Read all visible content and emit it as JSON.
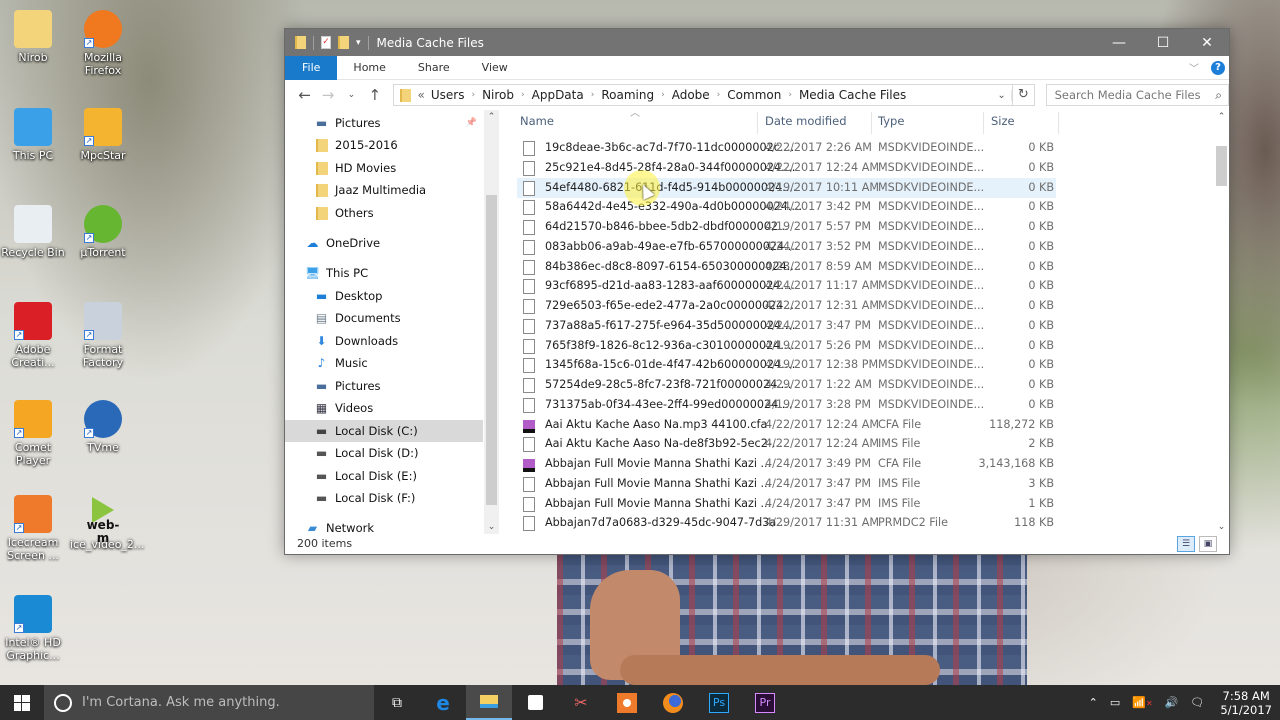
{
  "desktop": {
    "icons": [
      {
        "label": "Nirob",
        "icon": "user-folder-icon"
      },
      {
        "label": "Mozilla\nFirefox",
        "icon": "firefox-icon"
      },
      {
        "label": "This PC",
        "icon": "this-pc-icon"
      },
      {
        "label": "MpcStar",
        "icon": "mpcstar-icon"
      },
      {
        "label": "Recycle Bin",
        "icon": "recycle-bin-icon"
      },
      {
        "label": "µTorrent",
        "icon": "utorrent-icon"
      },
      {
        "label": "Adobe\nCreati...",
        "icon": "adobe-cc-icon"
      },
      {
        "label": "Format\nFactory",
        "icon": "format-factory-icon"
      },
      {
        "label": "Comet Player",
        "icon": "comet-player-icon"
      },
      {
        "label": "TVme",
        "icon": "tvme-icon"
      },
      {
        "label": "Icecream\nScreen ...",
        "icon": "icecream-icon"
      },
      {
        "label": "ice_video_2...",
        "icon": "webm-file-icon",
        "badge": "web-m"
      },
      {
        "label": "Intel® HD\nGraphic...",
        "icon": "intel-graphics-icon"
      }
    ]
  },
  "window": {
    "title": "Media Cache Files",
    "controls": {
      "minimize": "—",
      "maximize": "☐",
      "close": "✕"
    },
    "ribbon_tabs": [
      "File",
      "Home",
      "Share",
      "View"
    ],
    "address": {
      "overflow": "«",
      "crumbs": [
        "Users",
        "Nirob",
        "AppData",
        "Roaming",
        "Adobe",
        "Common",
        "Media Cache Files"
      ]
    },
    "search_placeholder": "Search Media Cache Files",
    "nav_pane": [
      {
        "label": "Pictures",
        "icon": "pictures-icon",
        "pinned": true
      },
      {
        "label": "2015-2016",
        "icon": "folder-icon"
      },
      {
        "label": "HD Movies",
        "icon": "folder-icon"
      },
      {
        "label": "Jaaz Multimedia",
        "icon": "folder-icon"
      },
      {
        "label": "Others",
        "icon": "folder-icon"
      },
      {
        "label": "OneDrive",
        "icon": "onedrive-icon"
      },
      {
        "label": "This PC",
        "icon": "this-pc-icon"
      },
      {
        "label": "Desktop",
        "icon": "desktop-icon"
      },
      {
        "label": "Documents",
        "icon": "documents-icon"
      },
      {
        "label": "Downloads",
        "icon": "downloads-icon"
      },
      {
        "label": "Music",
        "icon": "music-icon"
      },
      {
        "label": "Pictures",
        "icon": "pictures-icon"
      },
      {
        "label": "Videos",
        "icon": "videos-icon"
      },
      {
        "label": "Local Disk (C:)",
        "icon": "system-drive-icon",
        "selected": true
      },
      {
        "label": "Local Disk (D:)",
        "icon": "drive-icon"
      },
      {
        "label": "Local Disk (E:)",
        "icon": "drive-icon"
      },
      {
        "label": "Local Disk (F:)",
        "icon": "drive-icon"
      },
      {
        "label": "Network",
        "icon": "network-icon"
      }
    ],
    "columns": {
      "name": "Name",
      "date": "Date modified",
      "type": "Type",
      "size": "Size"
    },
    "files": [
      {
        "name": "19c8deae-3b6c-ac7d-7f70-11dc0000002c....",
        "date": "4/22/2017 2:26 AM",
        "type": "MSDKVIDEOINDE...",
        "size": "0 KB",
        "icon": "file-icon"
      },
      {
        "name": "25c921e4-8d45-28f4-28a0-344f00000024....",
        "date": "4/22/2017 12:24 AM",
        "type": "MSDKVIDEOINDE...",
        "size": "0 KB",
        "icon": "file-icon"
      },
      {
        "name": "54ef4480-6821-611d-f4d5-914b00000024....",
        "date": "4/19/2017 10:11 AM",
        "type": "MSDKVIDEOINDE...",
        "size": "0 KB",
        "icon": "file-icon",
        "hover": true
      },
      {
        "name": "58a6442d-4e45-e332-490a-4d0b00000024....",
        "date": "4/24/2017 3:42 PM",
        "type": "MSDKVIDEOINDE...",
        "size": "0 KB",
        "icon": "file-icon"
      },
      {
        "name": "64d21570-b846-bbee-5db2-dbdf0000002...",
        "date": "4/19/2017 5:57 PM",
        "type": "MSDKVIDEOINDE...",
        "size": "0 KB",
        "icon": "file-icon"
      },
      {
        "name": "083abb06-a9ab-49ae-e7fb-657000000024....",
        "date": "4/24/2017 3:52 PM",
        "type": "MSDKVIDEOINDE...",
        "size": "0 KB",
        "icon": "file-icon"
      },
      {
        "name": "84b386ec-d8c8-8097-6154-650300000024....",
        "date": "4/23/2017 8:59 AM",
        "type": "MSDKVIDEOINDE...",
        "size": "0 KB",
        "icon": "file-icon"
      },
      {
        "name": "93cf6895-d21d-aa83-1283-aaf600000024....",
        "date": "4/24/2017 11:17 AM",
        "type": "MSDKVIDEOINDE...",
        "size": "0 KB",
        "icon": "file-icon"
      },
      {
        "name": "729e6503-f65e-ede2-477a-2a0c00000024....",
        "date": "4/22/2017 12:31 AM",
        "type": "MSDKVIDEOINDE...",
        "size": "0 KB",
        "icon": "file-icon"
      },
      {
        "name": "737a88a5-f617-275f-e964-35d500000024....",
        "date": "4/24/2017 3:47 PM",
        "type": "MSDKVIDEOINDE...",
        "size": "0 KB",
        "icon": "file-icon"
      },
      {
        "name": "765f38f9-1826-8c12-936a-c30100000024....",
        "date": "4/19/2017 5:26 PM",
        "type": "MSDKVIDEOINDE...",
        "size": "0 KB",
        "icon": "file-icon"
      },
      {
        "name": "1345f68a-15c6-01de-4f47-42b600000024....",
        "date": "4/19/2017 12:38 PM",
        "type": "MSDKVIDEOINDE...",
        "size": "0 KB",
        "icon": "file-icon"
      },
      {
        "name": "57254de9-28c5-8fc7-23f8-721f00000024....",
        "date": "4/29/2017 1:22 AM",
        "type": "MSDKVIDEOINDE...",
        "size": "0 KB",
        "icon": "file-icon"
      },
      {
        "name": "731375ab-0f34-43ee-2ff4-99ed00000024....",
        "date": "4/19/2017 3:28 PM",
        "type": "MSDKVIDEOINDE...",
        "size": "0 KB",
        "icon": "file-icon"
      },
      {
        "name": "Aai Aktu Kache Aaso Na.mp3 44100.cfa",
        "date": "4/22/2017 12:24 AM",
        "type": "CFA File",
        "size": "118,272 KB",
        "icon": "cfa-file-icon"
      },
      {
        "name": "Aai Aktu Kache Aaso Na-de8f3b92-5ec2-...",
        "date": "4/22/2017 12:24 AM",
        "type": "IMS File",
        "size": "2 KB",
        "icon": "file-icon"
      },
      {
        "name": "Abbajan  Full Movie  Manna  Shathi  Kazi ...",
        "date": "4/24/2017 3:49 PM",
        "type": "CFA File",
        "size": "3,143,168 KB",
        "icon": "cfa-file-icon"
      },
      {
        "name": "Abbajan  Full Movie  Manna  Shathi  Kazi ...",
        "date": "4/24/2017 3:47 PM",
        "type": "IMS File",
        "size": "3 KB",
        "icon": "file-icon"
      },
      {
        "name": "Abbajan  Full Movie  Manna  Shathi  Kazi ...",
        "date": "4/24/2017 3:47 PM",
        "type": "IMS File",
        "size": "1 KB",
        "icon": "file-icon"
      },
      {
        "name": "Abbajan7d7a0683-d329-45dc-9047-7d3a...",
        "date": "4/29/2017 11:31 AM",
        "type": "PRMDC2 File",
        "size": "118 KB",
        "icon": "file-icon"
      }
    ],
    "status": "200 items"
  },
  "taskbar": {
    "cortana_placeholder": "I'm Cortana. Ask me anything.",
    "apps": [
      "task-view-icon",
      "edge-icon",
      "file-explorer-icon",
      "store-icon",
      "snipping-tool-icon",
      "icecream-icon",
      "firefox-icon",
      "photoshop-icon",
      "premiere-icon"
    ],
    "ps_label": "Ps",
    "pr_label": "Pr",
    "time": "7:58 AM",
    "date": "5/1/2017"
  },
  "colors": {
    "accent": "#1979ca",
    "hover_row": "#e5f1fb",
    "titlebar": "#737373",
    "taskbar": "#2c2c2c"
  }
}
